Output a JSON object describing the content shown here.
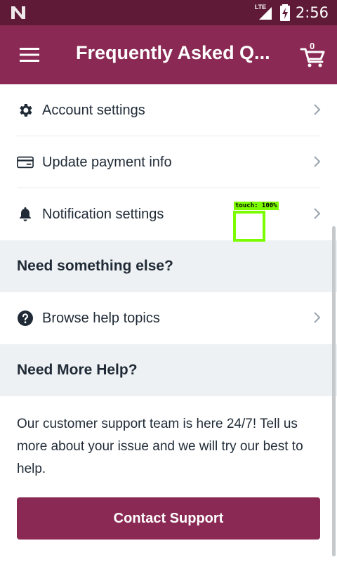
{
  "status_bar": {
    "time": "2:56",
    "network": "LTE"
  },
  "appbar": {
    "title": "Frequently Asked Q...",
    "cart_count": "0"
  },
  "menu_rows": [
    {
      "label": "Account settings",
      "icon": "gear-icon"
    },
    {
      "label": "Update payment info",
      "icon": "credit-card-icon"
    },
    {
      "label": "Notification settings",
      "icon": "bell-icon"
    }
  ],
  "section_else": {
    "title": "Need something else?"
  },
  "browse_row": {
    "label": "Browse help topics",
    "icon": "question-circle-icon"
  },
  "section_more": {
    "title": "Need More Help?"
  },
  "support": {
    "text": "Our customer support team is here 24/7! Tell us more about your issue and we will try our best to help.",
    "button_label": "Contact Support"
  },
  "touch_overlay": {
    "label": "touch: 100%"
  },
  "colors": {
    "status_bar": "#5e1a36",
    "brand": "#8a2a54",
    "section_bg": "#eef1f3",
    "touch": "#7cfc00"
  }
}
